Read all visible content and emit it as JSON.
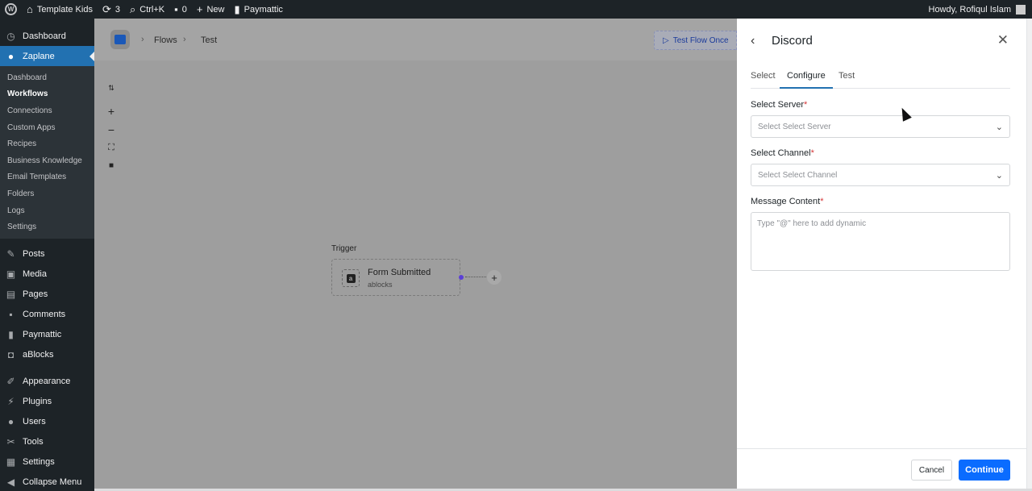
{
  "adminbar": {
    "site_name": "Template Kids",
    "updates_count": "3",
    "shortcut": "Ctrl+K",
    "comments_count": "0",
    "new_label": "New",
    "paymattic_label": "Paymattic",
    "greeting": "Howdy, Rofiqul Islam"
  },
  "sidebar": {
    "top_items": [
      {
        "label": "Dashboard",
        "icon": "dashboard-icon"
      },
      {
        "label": "Zaplane",
        "icon": "zaplane-icon"
      }
    ],
    "submenu": [
      "Dashboard",
      "Workflows",
      "Connections",
      "Custom Apps",
      "Recipes",
      "Business Knowledge",
      "Email Templates",
      "Folders",
      "Logs",
      "Settings"
    ],
    "items": [
      {
        "label": "Posts",
        "icon": "pin-icon"
      },
      {
        "label": "Media",
        "icon": "media-icon"
      },
      {
        "label": "Pages",
        "icon": "pages-icon"
      },
      {
        "label": "Comments",
        "icon": "comment-icon"
      },
      {
        "label": "Paymattic",
        "icon": "paymattic-icon"
      },
      {
        "label": "aBlocks",
        "icon": "ablocks-icon"
      },
      {
        "label": "Appearance",
        "icon": "brush-icon"
      },
      {
        "label": "Plugins",
        "icon": "plugin-icon"
      },
      {
        "label": "Users",
        "icon": "users-icon"
      },
      {
        "label": "Tools",
        "icon": "wrench-icon"
      },
      {
        "label": "Settings",
        "icon": "settings-icon"
      },
      {
        "label": "Collapse Menu",
        "icon": "collapse-icon"
      }
    ]
  },
  "canvas": {
    "breadcrumb": [
      "Flows",
      "Test"
    ],
    "test_flow_label": "Test Flow Once",
    "trigger_label": "Trigger",
    "node_title": "Form Submitted",
    "node_subtitle": "ablocks"
  },
  "panel": {
    "title": "Discord",
    "tabs": [
      "Select",
      "Configure",
      "Test"
    ],
    "active_tab": "Configure",
    "server_label": "Select Server",
    "server_placeholder": "Select Select Server",
    "channel_label": "Select Channel",
    "channel_placeholder": "Select Select Channel",
    "message_label": "Message Content",
    "message_placeholder": "Type \"@\" here to add dynamic",
    "required_mark": "*",
    "cancel_label": "Cancel",
    "continue_label": "Continue"
  },
  "colors": {
    "adminbar_bg": "#1d2327",
    "accent": "#2271b1",
    "primary_button": "#0a6cff",
    "required": "#d63638"
  }
}
